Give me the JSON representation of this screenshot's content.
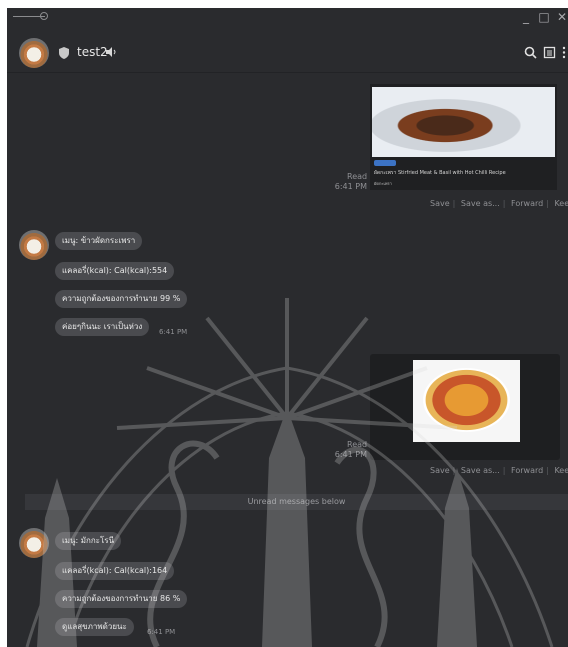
{
  "chat": {
    "name": "test2"
  },
  "link_preview": {
    "title": "ผัดกะเพรา Stirfried Meat & Basil with Hot Chilli Recipe",
    "subtitle": "ผัดกะเพรา"
  },
  "message_meta": {
    "read_label": "Read",
    "time1": "6:41 PM",
    "time2": "6:41 PM",
    "time3": "6:41 PM",
    "time4": "6:41 PM"
  },
  "actions": {
    "save": "Save",
    "save_as": "Save as...",
    "forward": "Forward",
    "keep": "Keep"
  },
  "bot_reply_1": {
    "menu": "เมนู: ข้าวผัดกระเพรา",
    "calories": "แคลอรี่(kcal): Cal(kcal):554",
    "accuracy": "ความถูกต้องของการทำนาย 99 %",
    "comment": "ค่อยๆกินนะ เราเป็นห่วง"
  },
  "unread": {
    "label": "Unread messages below"
  },
  "bot_reply_2": {
    "menu": "เมนู: มักกะโรนี",
    "calories": "แคลอรี่(kcal): Cal(kcal):164",
    "accuracy": "ความถูกต้องของการทำนาย 86 %",
    "comment": "ดูแลสุขภาพด้วยนะ"
  },
  "colors": {
    "background": "#2a2b2e",
    "bubble": "#4a4b4f",
    "text": "#e8e8e8",
    "muted": "#8f9094"
  },
  "icons": [
    "shield-icon",
    "speaker-icon",
    "search-icon",
    "info-icon",
    "more-icon",
    "minimize-icon",
    "maximize-icon",
    "close-icon"
  ]
}
